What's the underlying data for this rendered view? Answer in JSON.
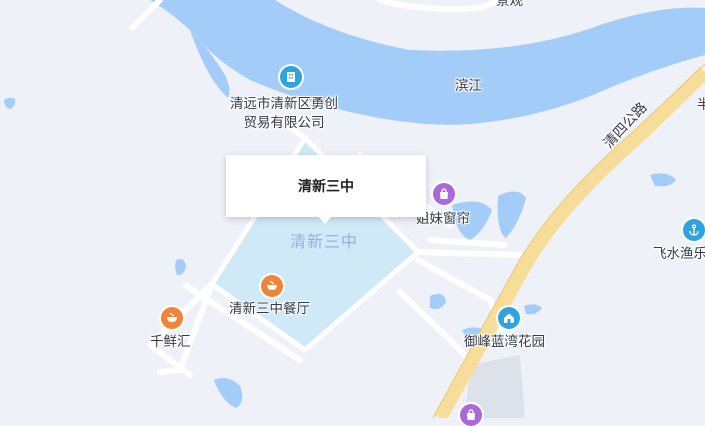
{
  "popup": {
    "title": "清新三中"
  },
  "map": {
    "colors": {
      "land": "#eef1f8",
      "water": "#a3cdf8",
      "campus": "#cfe9f6",
      "road_major": "#f6dd99",
      "road_minor": "#ffffff",
      "popup": "#ffffff"
    },
    "area_label": "清新三中",
    "labels": {
      "river": "滨江",
      "road": "清四公路",
      "top_partial": "景观",
      "right_partial": "半"
    },
    "pois": [
      {
        "name": "清远市清新区勇创\n贸易有限公司",
        "icon": "building-icon",
        "color": "#2ea3e0"
      },
      {
        "name": "姐妹窗帘",
        "icon": "shopping-bag-icon",
        "color": "#a86ad8"
      },
      {
        "name": "清新三中餐厅",
        "icon": "restaurant-bowl-icon",
        "color": "#f1843b"
      },
      {
        "name": "千鲜汇",
        "icon": "restaurant-bowl-icon",
        "color": "#f1843b"
      },
      {
        "name": "御峰蓝湾花园",
        "icon": "residential-icon",
        "color": "#2ea3e0"
      },
      {
        "name": "飞水渔乐",
        "icon": "anchor-icon",
        "color": "#2ea3e0"
      },
      {
        "name": "",
        "icon": "shopping-bag-icon",
        "color": "#a86ad8"
      }
    ]
  }
}
